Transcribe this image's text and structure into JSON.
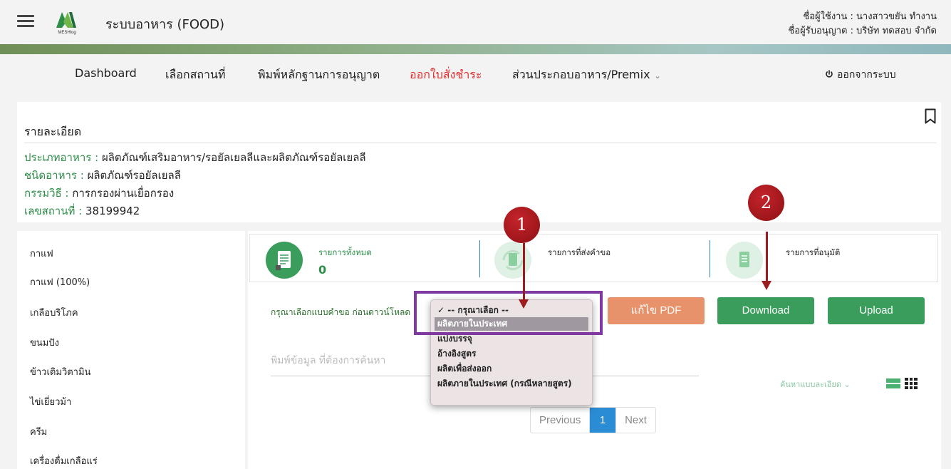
{
  "header": {
    "menu_icon": "hamburger-icon",
    "logo_text": "MESHlog",
    "app_title": "ระบบอาหาร (FOOD)",
    "user_line": "ชื่อผู้ใช้งาน : นางสาวขยัน ทำงาน",
    "licensee_line": "ชื่อผู้รับอนุญาต : บริษัท ทดสอบ จำกัด"
  },
  "nav": {
    "items": [
      "Dashboard",
      "เลือกสถานที่",
      "พิมพ์หลักฐานการอนุญาต",
      "ออกใบสั่งชำระ",
      "ส่วนประกอบอาหาร/Premix"
    ],
    "active_index": 3,
    "chevron": "⌄",
    "logout_icon": "power-icon",
    "logout_label": "ออกจากระบบ"
  },
  "detail": {
    "heading": "รายละเอียด",
    "rows": [
      {
        "key": "ประเภทอาหาร :",
        "value": "ผลิตภัณฑ์เสริมอาหาร/รอยัลเยลลีและผลิตภัณฑ์รอยัลเยลลี"
      },
      {
        "key": "ชนิดอาหาร :",
        "value": "ผลิตภัณฑ์รอยัลเยลลี"
      },
      {
        "key": "กรรมวิธี :",
        "value": "การกรองผ่านเยื่อกรอง"
      },
      {
        "key": "เลขสถานที่ :",
        "value": "38199942"
      }
    ],
    "bookmark_icon": "bookmark-icon"
  },
  "sidebar": {
    "items": [
      "กาแฟ",
      "กาแฟ (100%)",
      "เกลือบริโภค",
      "ขนมปัง",
      "ข้าวเติมวิตามิน",
      "ไข่เยี่ยวม้า",
      "ครีม",
      "เครื่องดื่มเกลือแร่"
    ]
  },
  "stats": [
    {
      "label": "รายการทั้งหมด",
      "count": "0",
      "icon": "document-icon",
      "color": "#3a9d5c"
    },
    {
      "label": "รายการที่ส่งคำขอ",
      "count": "",
      "icon": "refresh-document-icon",
      "color": "#dff0e4"
    },
    {
      "label": "รายการที่อนุมัติ",
      "count": "",
      "icon": "approved-document-icon",
      "color": "#dff0e4"
    }
  ],
  "form": {
    "prompt": "กรุณาเลือกแบบคำขอ ก่อนดาวน์โหลด",
    "dropdown_options": [
      "✓ -- กรุณาเลือก --",
      "ผลิตภายในประเทศ",
      "แบ่งบรรจุ",
      "อ้างอิงสูตร",
      "ผลิตเพื่อส่งออก",
      "ผลิตภายในประเทศ (กรณีหลายสูตร)"
    ],
    "highlighted_option_index": 1,
    "buttons": {
      "edit_pdf": "แก้ไข PDF",
      "download": "Download",
      "upload": "Upload"
    },
    "search_placeholder": "พิมพ์ข้อมูล ที่ต้องการค้นหา",
    "advanced_search": "ค้นหาแบบละเอียด ⌄"
  },
  "pagination": {
    "previous": "Previous",
    "current": "1",
    "next": "Next"
  },
  "annotations": {
    "marker_1": "1",
    "marker_2": "2"
  },
  "colors": {
    "green": "#3a9d5c",
    "orange": "#e8926b",
    "active_nav": "#e32b2b",
    "highlight_box": "#7e3aa0",
    "marker": "#a81b1f"
  }
}
